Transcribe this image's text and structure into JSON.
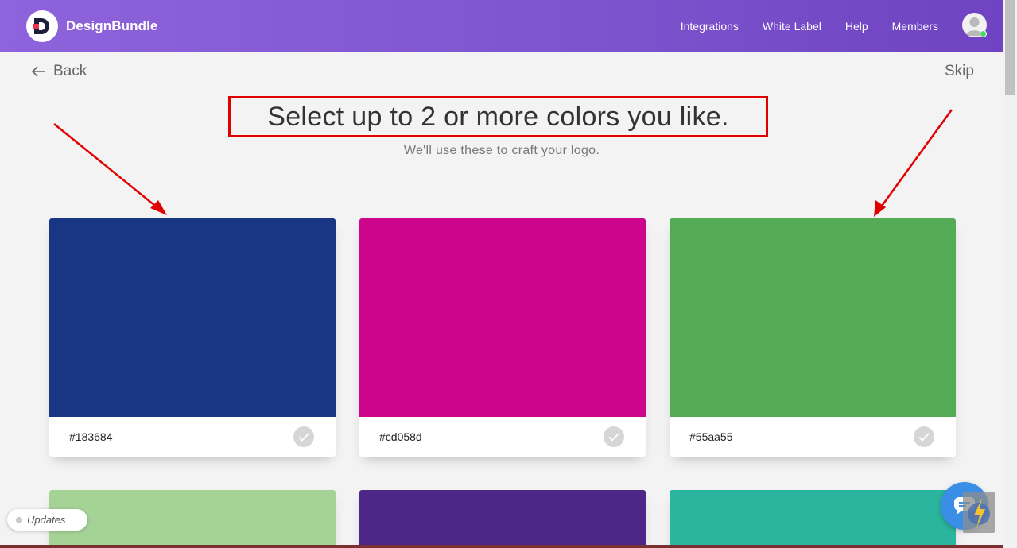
{
  "header": {
    "brand": "DesignBundle",
    "nav": [
      "Integrations",
      "White Label",
      "Help",
      "Members"
    ]
  },
  "page": {
    "back_label": "Back",
    "skip_label": "Skip",
    "title": "Select up to 2 or more colors you like.",
    "subtitle": "We'll use these to craft your logo."
  },
  "colors": [
    {
      "hex": "#183684",
      "swatch": "#183684"
    },
    {
      "hex": "#cd058d",
      "swatch": "#cd058d"
    },
    {
      "hex": "#55aa55",
      "swatch": "#55aa55"
    },
    {
      "hex": "",
      "swatch": "#a5d396"
    },
    {
      "hex": "",
      "swatch": "#4d2787"
    },
    {
      "hex": "",
      "swatch": "#2bb49e"
    }
  ],
  "widgets": {
    "updates_label": "Updates"
  },
  "theme": {
    "accent": "#8160d3",
    "highlight_red": "#e00000",
    "chat_blue": "#3a8ee6"
  }
}
